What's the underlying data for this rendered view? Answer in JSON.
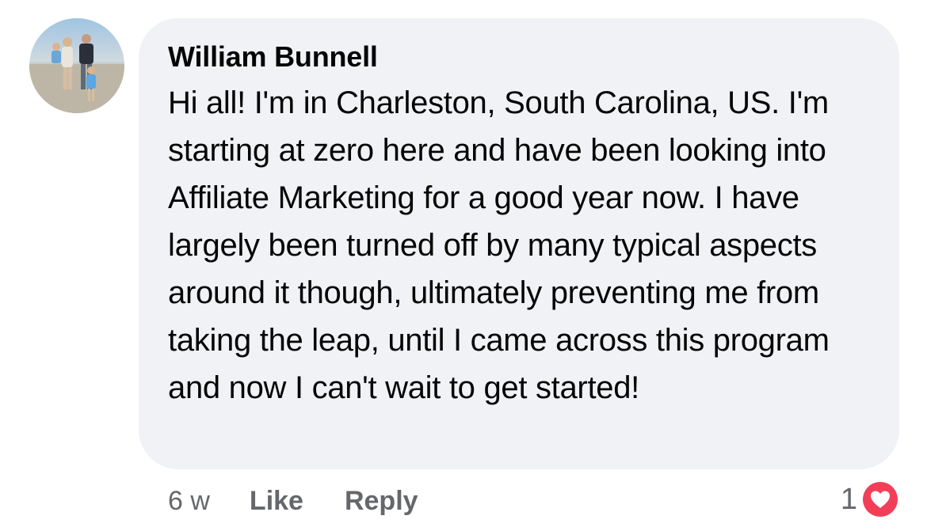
{
  "comment": {
    "author": "William Bunnell",
    "text": "Hi all! I'm in Charleston, South Carolina, US. I'm starting at zero here and have been looking into Affiliate Marketing for a good year now. I have largely been turned off by many typical aspects around it though, ultimately preventing me from taking the leap, until I came across this program and now I can't wait to get started!",
    "avatar_icon": "profile-photo"
  },
  "actions": {
    "timestamp": "6 w",
    "like_label": "Like",
    "reply_label": "Reply"
  },
  "reactions": {
    "count": "1",
    "icon": "love-reaction-icon",
    "color": "#f33e58"
  },
  "colors": {
    "bubble": "#f0f2f5",
    "text_primary": "#050505",
    "text_secondary": "#65676b"
  }
}
